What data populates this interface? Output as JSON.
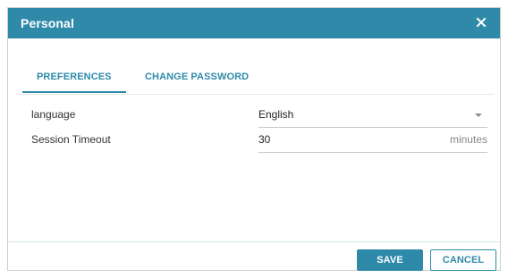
{
  "dialog": {
    "title": "Personal",
    "close_icon": "close-icon",
    "accent_color": "#2f8aa9"
  },
  "tabs": [
    {
      "label": "PREFERENCES",
      "active": true
    },
    {
      "label": "CHANGE PASSWORD",
      "active": false
    }
  ],
  "preferences": {
    "language": {
      "label": "language",
      "value": "English",
      "icon": "dropdown-caret-icon"
    },
    "session_timeout": {
      "label": "Session Timeout",
      "value": "30",
      "unit": "minutes"
    }
  },
  "footer": {
    "save_label": "SAVE",
    "cancel_label": "CANCEL"
  }
}
